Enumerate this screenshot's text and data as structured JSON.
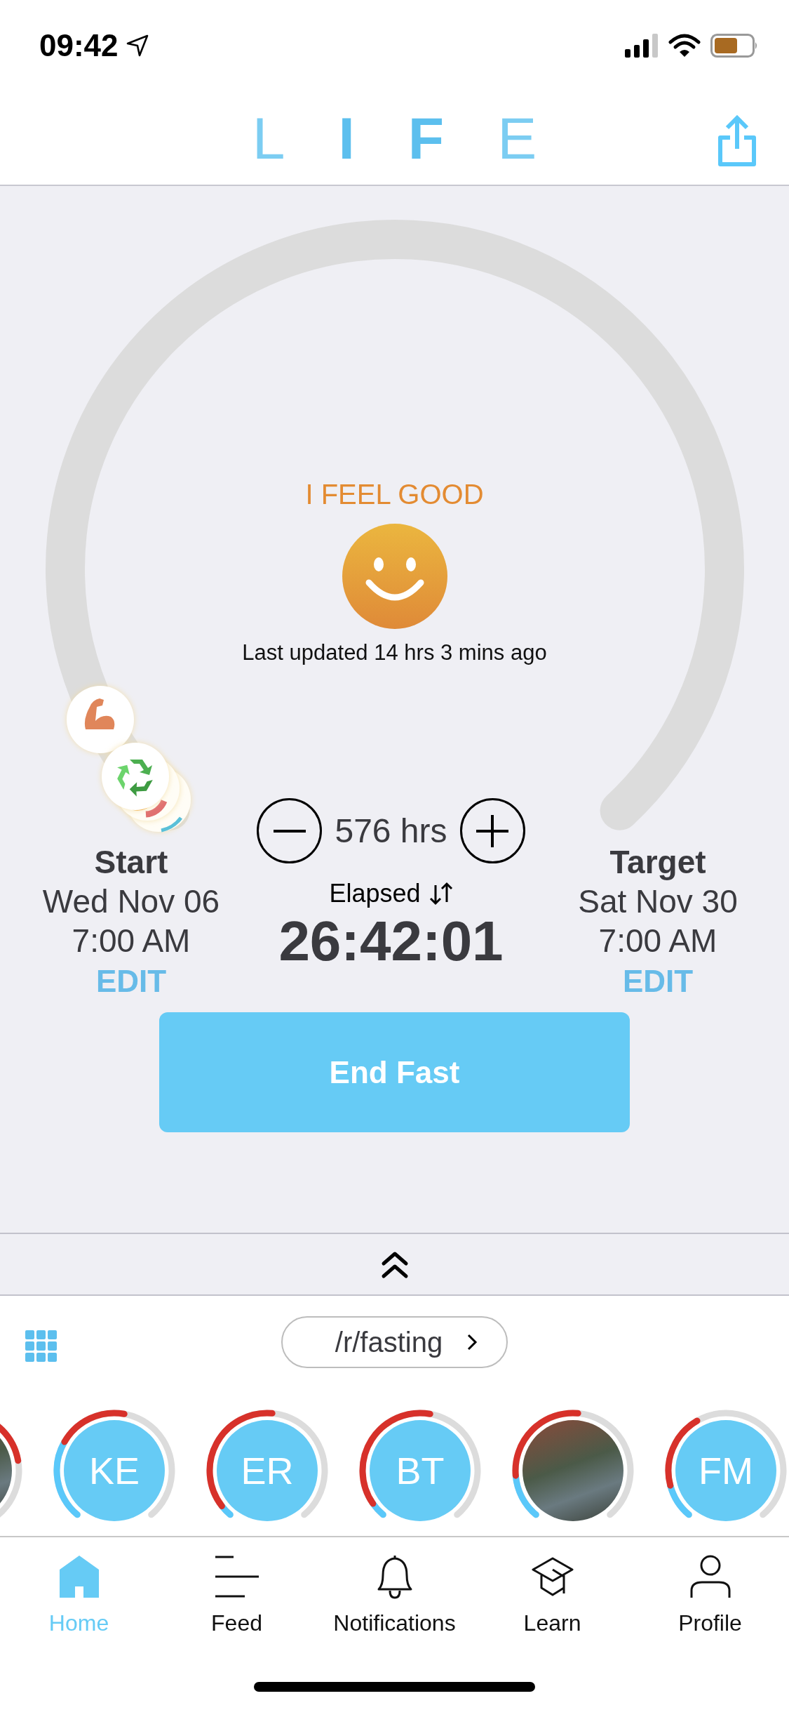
{
  "status_bar": {
    "time": "09:42"
  },
  "header": {
    "logo": [
      {
        "letter": "L",
        "bold": false
      },
      {
        "letter": "I",
        "bold": true
      },
      {
        "letter": "F",
        "bold": true
      },
      {
        "letter": "E",
        "bold": false
      }
    ]
  },
  "mood": {
    "label": "I FEEL GOOD",
    "last_updated": "Last updated 14 hrs 3 mins ago"
  },
  "duration": {
    "value": "576 hrs"
  },
  "start": {
    "label": "Start",
    "date": "Wed Nov 06",
    "time": "7:00 AM",
    "action": "EDIT"
  },
  "elapsed": {
    "label": "Elapsed",
    "timer": "26:42:01"
  },
  "target": {
    "label": "Target",
    "date": "Sat Nov 30",
    "time": "7:00 AM",
    "action": "EDIT"
  },
  "end_button": "End Fast",
  "community": {
    "label": "/r/fasting"
  },
  "members": [
    {
      "kind": "photo"
    },
    {
      "kind": "initials",
      "initials": "KE"
    },
    {
      "kind": "initials",
      "initials": "ER"
    },
    {
      "kind": "initials",
      "initials": "BT"
    },
    {
      "kind": "photo"
    },
    {
      "kind": "initials",
      "initials": "FM"
    }
  ],
  "tabs": [
    {
      "label": "Home",
      "selected": true
    },
    {
      "label": "Feed",
      "selected": false
    },
    {
      "label": "Notifications",
      "selected": false
    },
    {
      "label": "Learn",
      "selected": false
    },
    {
      "label": "Profile",
      "selected": false
    }
  ]
}
